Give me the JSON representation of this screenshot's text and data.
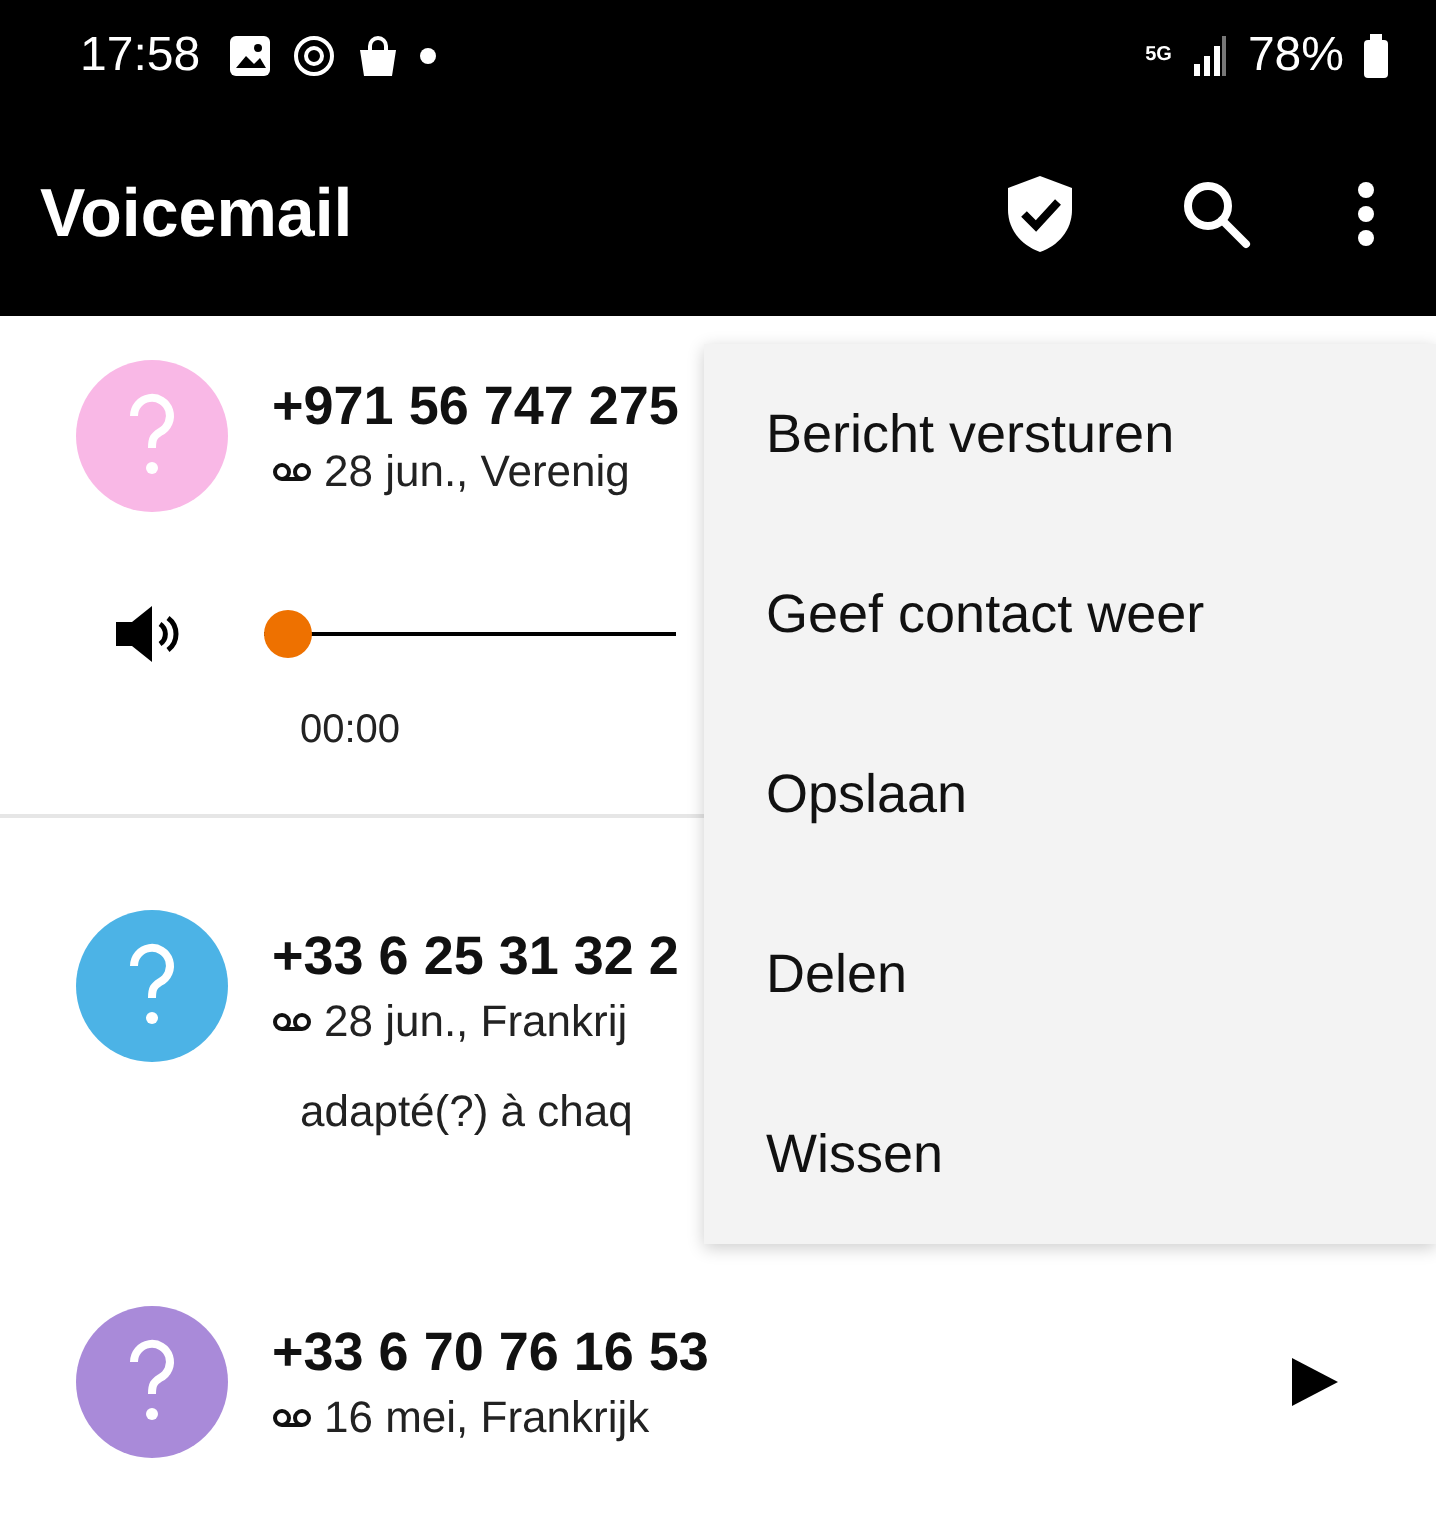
{
  "status_bar": {
    "time": "17:58",
    "network": "5G",
    "battery": "78%"
  },
  "app_bar": {
    "title": "Voicemail"
  },
  "voicemails": [
    {
      "kind": "expanded",
      "number": "+971 56 747 275",
      "detail": "28 jun., Verenig",
      "color": "#f9b8e6",
      "player": {
        "level": 0,
        "time": "00:00"
      }
    },
    {
      "kind": "transcript",
      "number": "+33 6 25 31 32 2",
      "detail": "28 jun., Frankrij",
      "transcript": "adapté(?) à chaq",
      "color": "#4cb3e6"
    },
    {
      "kind": "collapsed",
      "number": "+33 6 70 76 16 53",
      "detail": "16 mei, Frankrijk",
      "color": "#a98ad9"
    }
  ],
  "menu": {
    "items": [
      "Bericht versturen",
      "Geef contact weer",
      "Opslaan",
      "Delen",
      "Wissen"
    ]
  }
}
